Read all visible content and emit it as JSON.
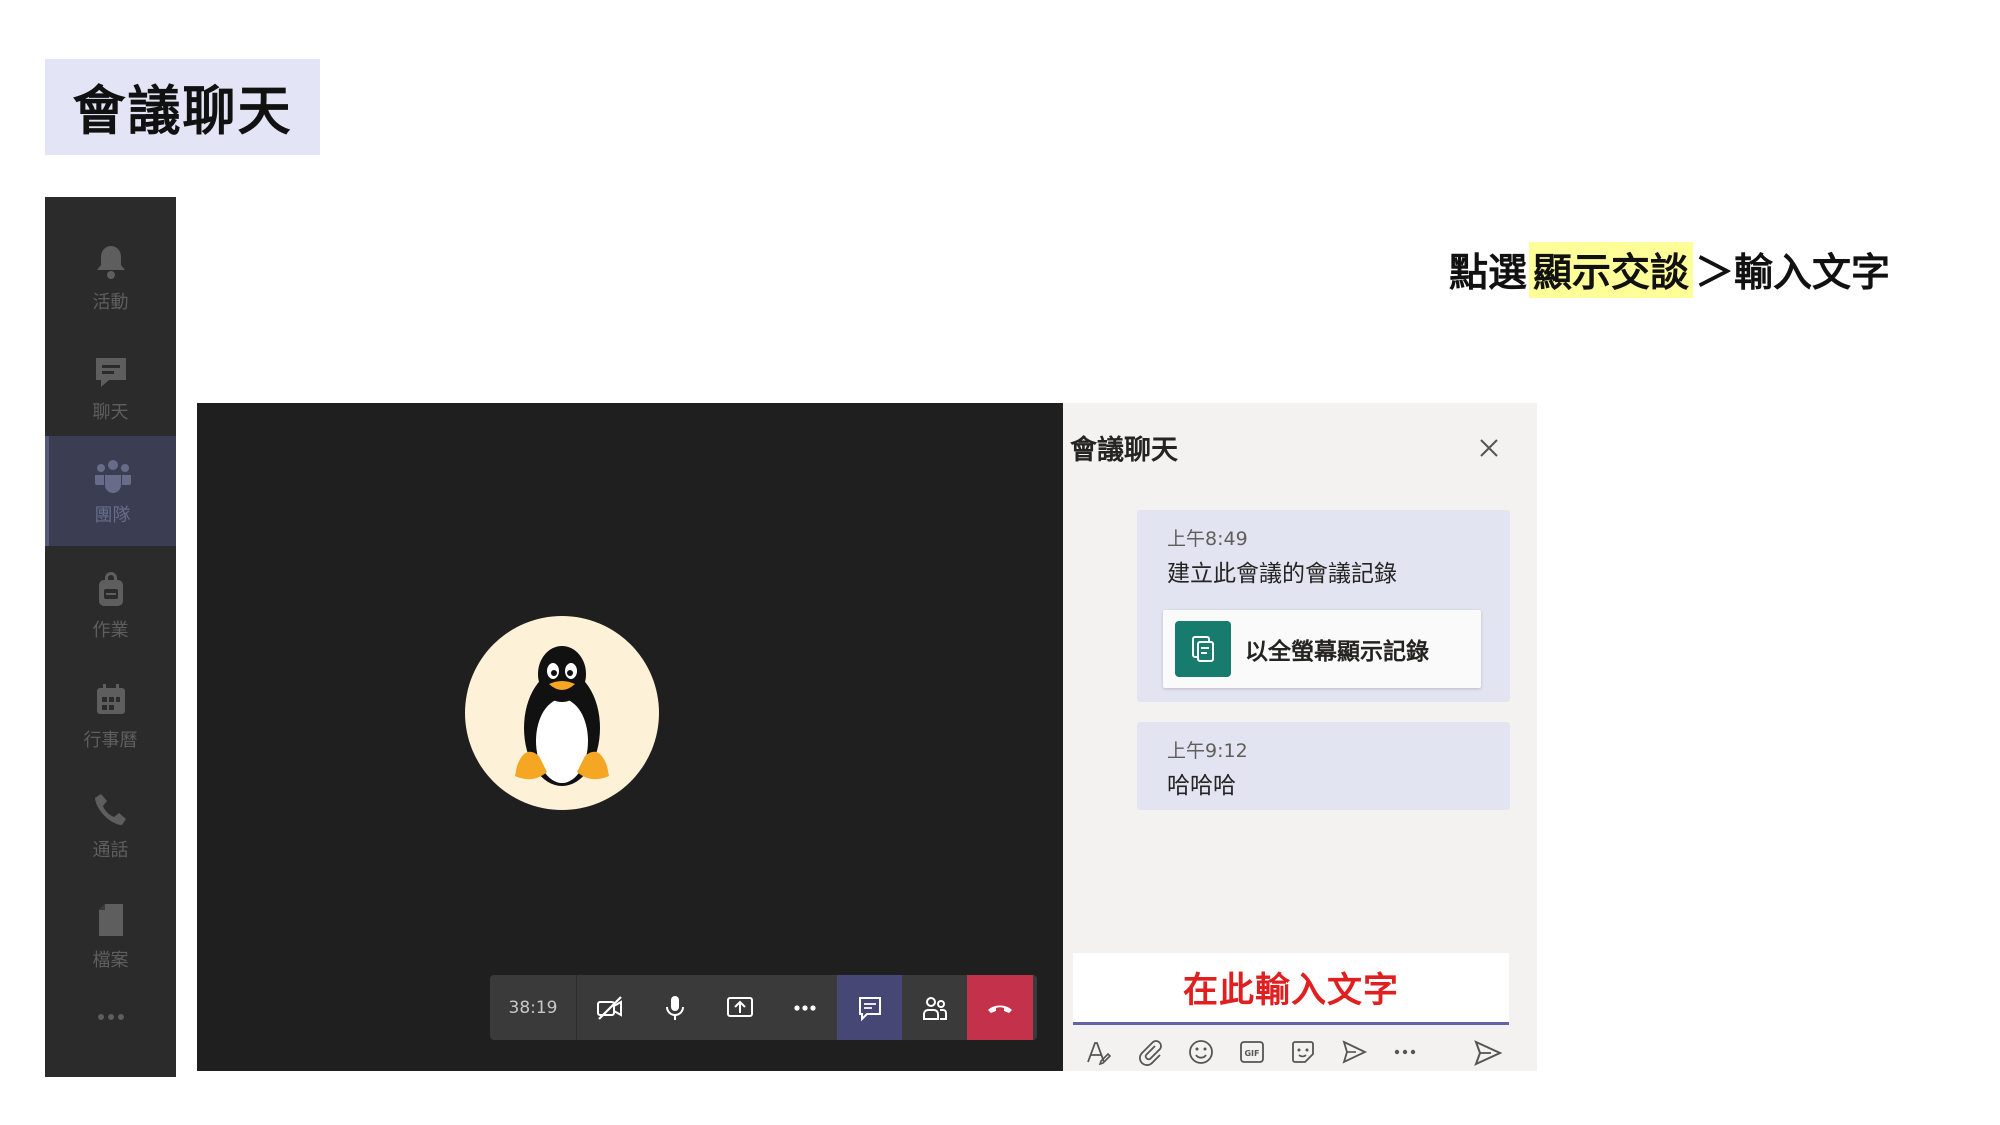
{
  "page_title": "會議聊天",
  "instruction": {
    "prefix": "點選",
    "highlight": "顯示交談",
    "suffix": "＞輸入文字"
  },
  "rail": {
    "items": [
      {
        "label": "活動",
        "icon": "bell-icon"
      },
      {
        "label": "聊天",
        "icon": "chat-icon"
      },
      {
        "label": "團隊",
        "icon": "teams-icon"
      },
      {
        "label": "作業",
        "icon": "backpack-icon"
      },
      {
        "label": "行事曆",
        "icon": "calendar-icon"
      },
      {
        "label": "通話",
        "icon": "phone-icon"
      },
      {
        "label": "檔案",
        "icon": "file-icon"
      }
    ],
    "active": "團隊",
    "more": "more-icon"
  },
  "call": {
    "timer": "38:19",
    "avatar": "tux-penguin-avatar"
  },
  "chat_panel": {
    "title": "會議聊天",
    "messages": [
      {
        "time": "上午8:49",
        "text": "建立此會議的會議記錄",
        "card_label": "以全螢幕顯示記錄"
      },
      {
        "time": "上午9:12",
        "text": "哈哈哈"
      }
    ],
    "compose_hint": "在此輸入文字"
  },
  "colors": {
    "title_bg": "#e3e5f7",
    "rail_bg": "#2b2b2b",
    "video_bg": "#1f1f1f",
    "accent": "#6264a7",
    "hangup": "#c4314b",
    "highlight": "#ffff99",
    "compose_text": "#e02020",
    "card_icon": "#177c6d"
  }
}
